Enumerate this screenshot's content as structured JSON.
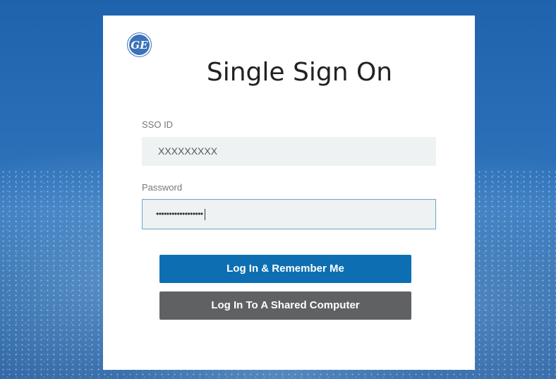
{
  "logo": {
    "text": "GE",
    "icon": "ge-monogram-icon"
  },
  "title": "Single Sign On",
  "form": {
    "sso_label": "SSO ID",
    "sso_value": "XXXXXXXXX",
    "password_label": "Password",
    "password_value": "••••••••••••••••••"
  },
  "buttons": {
    "remember": "Log In & Remember Me",
    "shared": "Log In To A Shared Computer"
  },
  "colors": {
    "primary_button": "#0d6fb2",
    "secondary_button": "#606163",
    "focus_border": "#6ba6c9",
    "background": "#2a6fb7"
  }
}
